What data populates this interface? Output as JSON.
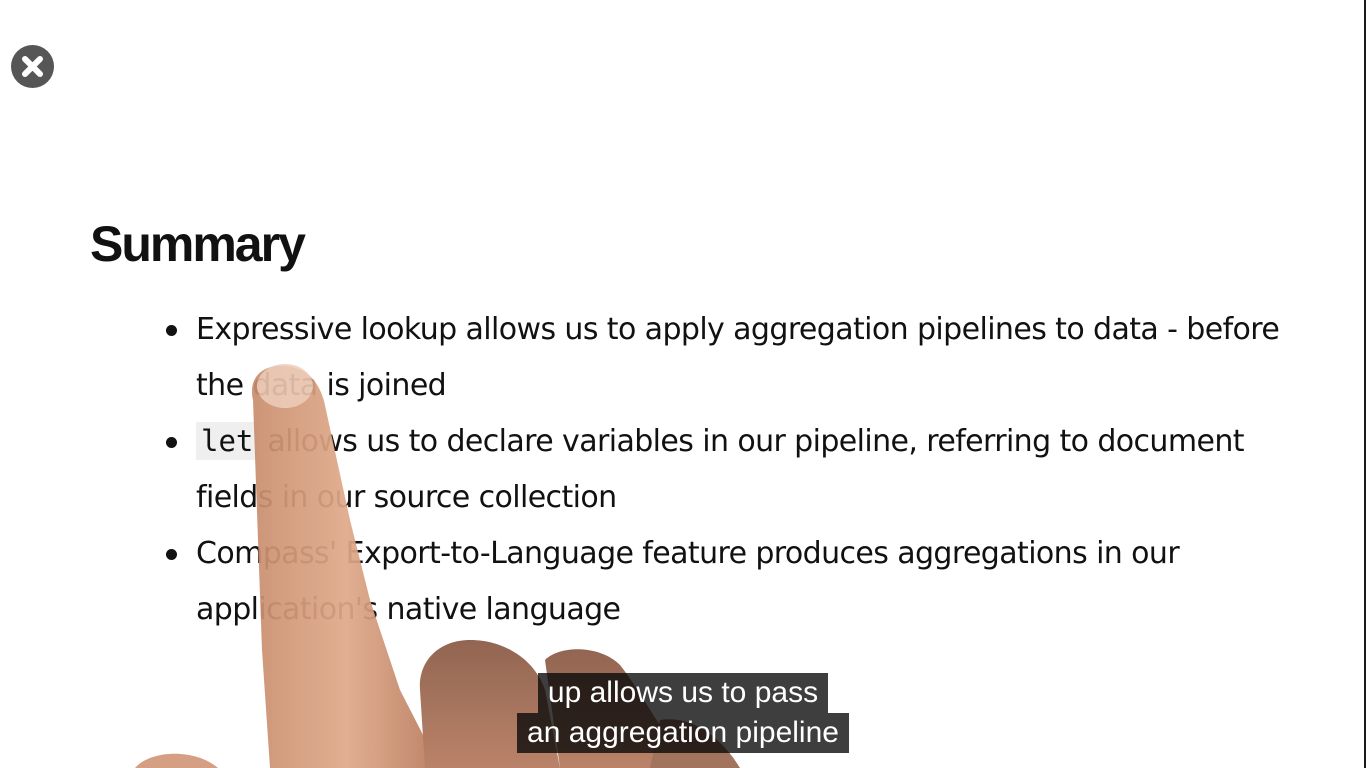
{
  "slide": {
    "title": "Summary",
    "bullets": [
      {
        "text": "Expressive lookup allows us to apply aggregation pipelines to data - before the data is joined"
      },
      {
        "code": "let",
        "text": " allows us to declare variables in our pipeline, referring to document fields in our source collection"
      },
      {
        "text": "Compass' Export-to-Language feature produces aggregations in our application's native language"
      }
    ]
  },
  "caption": {
    "line1": "up allows us to pass",
    "line2": "an aggregation pipeline"
  },
  "controls": {
    "close_icon": "close-icon"
  },
  "colors": {
    "close_button": "#565656",
    "caption_background": "#080808",
    "caption_text": "#ffffff",
    "code_background": "#efefef"
  }
}
